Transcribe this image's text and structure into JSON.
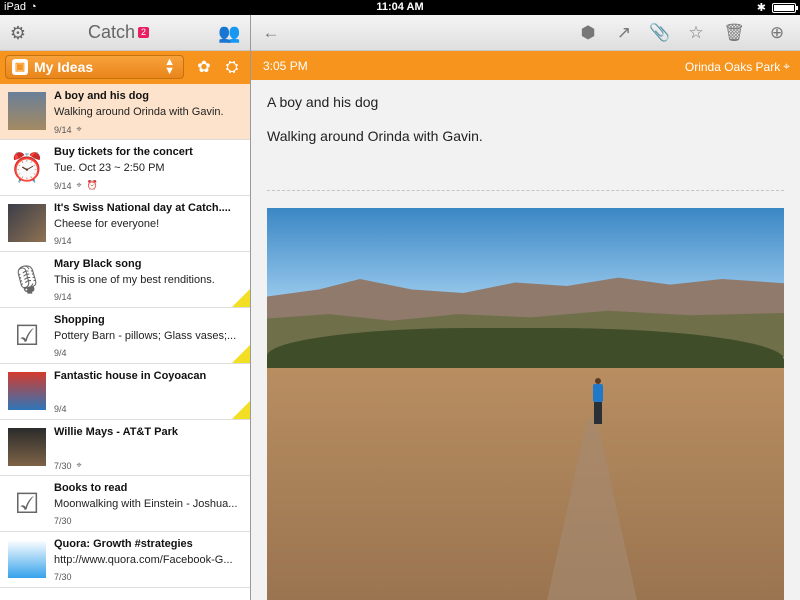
{
  "status_bar": {
    "device": "iPad",
    "time": "11:04 AM"
  },
  "left_header": {
    "app_title": "Catch",
    "badge": "2"
  },
  "filter": {
    "selected": "My Ideas"
  },
  "notes": [
    {
      "title": "A boy and his dog",
      "subtitle": "Walking around Orinda with Gavin.",
      "date": "9/14"
    },
    {
      "title": "Buy tickets for the concert",
      "subtitle": "Tue. Oct 23 ~ 2:50 PM",
      "date": "9/14"
    },
    {
      "title": "It's Swiss National day at Catch....",
      "subtitle": "Cheese for everyone!",
      "date": "9/14"
    },
    {
      "title": "Mary Black song",
      "subtitle": "This is one of my best renditions.",
      "date": "9/14"
    },
    {
      "title": "Shopping",
      "subtitle": "Pottery Barn - pillows; Glass vases;...",
      "date": "9/4"
    },
    {
      "title": "Fantastic house in Coyoacan",
      "subtitle": "",
      "date": "9/4"
    },
    {
      "title": "Willie Mays - AT&T Park",
      "subtitle": "",
      "date": "7/30"
    },
    {
      "title": "Books to read",
      "subtitle": "Moonwalking with Einstein - Joshua...",
      "date": "7/30"
    },
    {
      "title": "Quora: Growth #strategies",
      "subtitle": "http://www.quora.com/Facebook-G...",
      "date": "7/30"
    }
  ],
  "detail": {
    "time": "3:05 PM",
    "location": "Orinda Oaks Park",
    "title": "A boy and his dog",
    "body": "Walking around Orinda with Gavin."
  },
  "theme": {
    "orange": "#f7941d",
    "selected_row": "#fde3cb",
    "badge": "#e91e63",
    "corner_flag": "#f2df24"
  }
}
